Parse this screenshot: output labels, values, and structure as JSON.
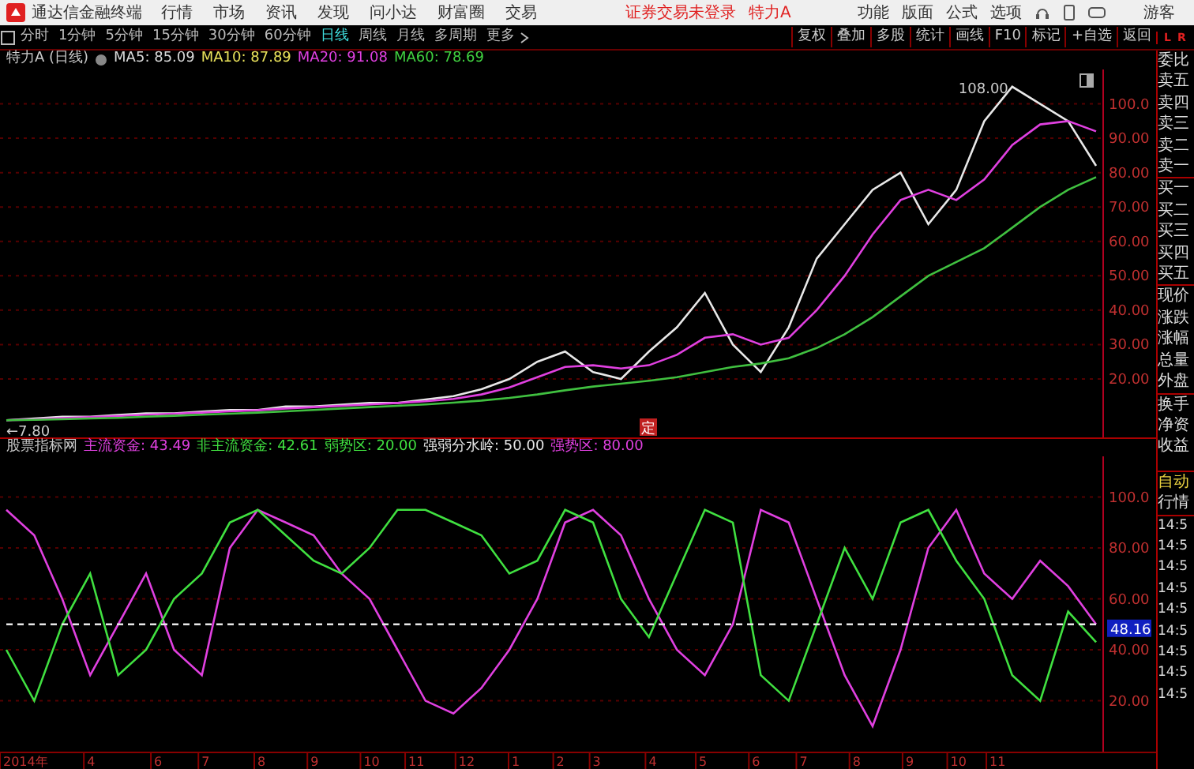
{
  "app": {
    "title": "通达信金融终端",
    "menu": [
      "行情",
      "市场",
      "资讯",
      "发现",
      "问小达",
      "财富圈",
      "交易"
    ],
    "trade_notice": "证券交易未登录",
    "stock": "特力A",
    "right_menu": [
      "功能",
      "版面",
      "公式",
      "选项"
    ],
    "user": "游客"
  },
  "toolbar": {
    "periods": [
      {
        "label": "分时",
        "selected": false
      },
      {
        "label": "1分钟",
        "selected": false
      },
      {
        "label": "5分钟",
        "selected": false
      },
      {
        "label": "15分钟",
        "selected": false
      },
      {
        "label": "30分钟",
        "selected": false
      },
      {
        "label": "60分钟",
        "selected": false
      },
      {
        "label": "日线",
        "selected": true
      },
      {
        "label": "周线",
        "selected": false
      },
      {
        "label": "月线",
        "selected": false
      },
      {
        "label": "多周期",
        "selected": false
      },
      {
        "label": "更多",
        "selected": false
      }
    ],
    "actions": [
      "复权",
      "叠加",
      "多股",
      "统计",
      "画线",
      "F10",
      "标记",
      "+自选",
      "返回"
    ],
    "corner": [
      "L",
      "R"
    ]
  },
  "price_legend": {
    "title": "特力A (日线)",
    "items": [
      {
        "label": "MA5: 85.09",
        "color": "#d8d8d8"
      },
      {
        "label": "MA10: 87.89",
        "color": "#e8e05a"
      },
      {
        "label": "MA20: 91.08",
        "color": "#e040e0"
      },
      {
        "label": "MA60: 78.69",
        "color": "#40d040"
      }
    ]
  },
  "main_chart": {
    "event_marker": "定",
    "chart_data": {
      "type": "line",
      "grid": true,
      "ylim": [
        3,
        110
      ],
      "yticks": [
        {
          "value": 20,
          "label": "20.00"
        },
        {
          "value": 30,
          "label": "30.00"
        },
        {
          "value": 40,
          "label": "40.00"
        },
        {
          "value": 50,
          "label": "50.00"
        },
        {
          "value": 60,
          "label": "60.00"
        },
        {
          "value": 70,
          "label": "70.00"
        },
        {
          "value": 80,
          "label": "80.00"
        },
        {
          "value": 90,
          "label": "90.00"
        },
        {
          "value": 100,
          "label": "100.0"
        }
      ],
      "series": [
        {
          "color": "#e8e8e8",
          "values": [
            8,
            8.5,
            9,
            9,
            9.5,
            10,
            10,
            10.5,
            11,
            11,
            12,
            12,
            12.5,
            13,
            13,
            14,
            15,
            17,
            20,
            25,
            28,
            22,
            20,
            28,
            35,
            45,
            30,
            22,
            35,
            55,
            65,
            75,
            80,
            65,
            75,
            95,
            105,
            100,
            95,
            82
          ]
        },
        {
          "color": "#e040e0",
          "values": [
            8,
            8.2,
            8.6,
            8.9,
            9.2,
            9.6,
            9.9,
            10.2,
            10.6,
            10.9,
            11.4,
            11.8,
            12.2,
            12.6,
            13,
            13.5,
            14.2,
            15.5,
            17.5,
            20.5,
            23.5,
            24,
            23,
            24,
            27,
            32,
            33,
            30,
            32,
            40,
            50,
            62,
            72,
            75,
            72,
            78,
            88,
            94,
            95,
            92
          ]
        },
        {
          "color": "#40c040",
          "values": [
            8,
            8.1,
            8.3,
            8.5,
            8.7,
            9,
            9.3,
            9.6,
            9.9,
            10.2,
            10.6,
            11,
            11.4,
            11.8,
            12.2,
            12.6,
            13.1,
            13.7,
            14.5,
            15.5,
            16.7,
            17.8,
            18.6,
            19.5,
            20.5,
            22,
            23.5,
            24.5,
            26,
            29,
            33,
            38,
            44,
            50,
            54,
            58,
            64,
            70,
            75,
            78.7
          ]
        }
      ],
      "annotations": [
        "108.00",
        "←7.80"
      ]
    }
  },
  "indicator": {
    "legend": [
      {
        "label": "股票指标网",
        "color": "#c8c8c8"
      },
      {
        "label": "主流资金: 43.49",
        "color": "#e040e0"
      },
      {
        "label": "非主流资金: 42.61",
        "color": "#40e040"
      },
      {
        "label": "弱势区: 20.00",
        "color": "#40e040"
      },
      {
        "label": "强弱分水岭: 50.00",
        "color": "#e8e8e8"
      },
      {
        "label": "强势区: 80.00",
        "color": "#e040e0"
      }
    ],
    "current_value": "48.16",
    "x_axis_labels": [
      "2014年",
      "4",
      "6",
      "7",
      "8",
      "9",
      "10",
      "11",
      "12",
      "1",
      "2",
      "3",
      "4",
      "5",
      "6",
      "7",
      "8",
      "9",
      "10",
      "11"
    ],
    "chart_data": {
      "type": "line",
      "grid": true,
      "ylim": [
        0,
        116
      ],
      "yticks": [
        {
          "value": 20,
          "label": "20.00"
        },
        {
          "value": 40,
          "label": "40.00"
        },
        {
          "value": 60,
          "label": "60.00"
        },
        {
          "value": 80,
          "label": "80.00"
        },
        {
          "value": 100,
          "label": "100.0"
        }
      ],
      "series": [
        {
          "color": "#e040e0",
          "values": [
            95,
            85,
            60,
            30,
            50,
            70,
            40,
            30,
            80,
            95,
            90,
            85,
            70,
            60,
            40,
            20,
            15,
            25,
            40,
            60,
            90,
            95,
            85,
            60,
            40,
            30,
            50,
            95,
            90,
            60,
            30,
            10,
            40,
            80,
            95,
            70,
            60,
            75,
            65,
            50
          ]
        },
        {
          "color": "#40e040",
          "values": [
            40,
            20,
            50,
            70,
            30,
            40,
            60,
            70,
            90,
            95,
            85,
            75,
            70,
            80,
            95,
            95,
            90,
            85,
            70,
            75,
            95,
            90,
            60,
            45,
            70,
            95,
            90,
            30,
            20,
            50,
            80,
            60,
            90,
            95,
            75,
            60,
            30,
            20,
            55,
            43
          ]
        },
        {
          "color": "#e8e8e8",
          "line_style": "dashed",
          "values": [
            50,
            50,
            50,
            50,
            50,
            50,
            50,
            50,
            50,
            50,
            50,
            50,
            50,
            50,
            50,
            50,
            50,
            50,
            50,
            50,
            50,
            50,
            50,
            50,
            50,
            50,
            50,
            50,
            50,
            50,
            50,
            50,
            50,
            50,
            50,
            50,
            50,
            50,
            50,
            50
          ]
        }
      ]
    }
  },
  "quote_panel": {
    "labels": [
      "委比",
      "卖五",
      "卖四",
      "卖三",
      "卖二",
      "卖一",
      "买一",
      "买二",
      "买三",
      "买四",
      "买五",
      "现价",
      "涨跌",
      "涨幅",
      "总量",
      "外盘",
      "换手",
      "净资",
      "收益"
    ],
    "mode": [
      "自动",
      "行情"
    ],
    "times": [
      "14:5",
      "14:5",
      "14:5",
      "14:5",
      "14:5",
      "14:5",
      "14:5",
      "14:5",
      "14:5"
    ]
  }
}
